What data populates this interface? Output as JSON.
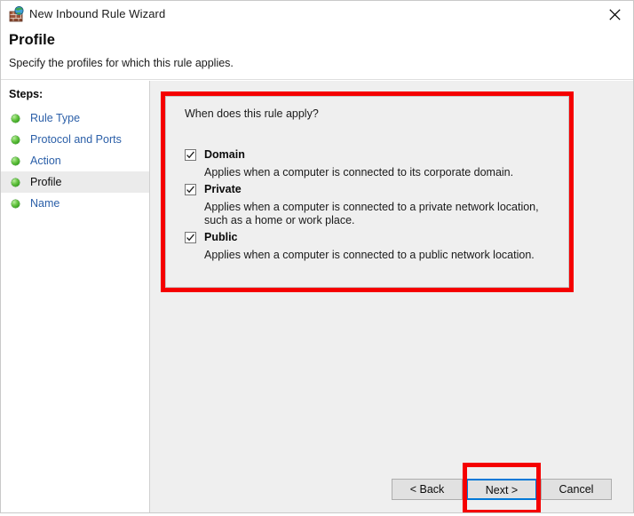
{
  "window": {
    "title": "New Inbound Rule Wizard",
    "icon": "firewall-globe-icon",
    "close_icon": "close-icon"
  },
  "header": {
    "title": "Profile",
    "subtitle": "Specify the profiles for which this rule applies."
  },
  "sidebar": {
    "label": "Steps:",
    "items": [
      {
        "label": "Rule Type",
        "current": false
      },
      {
        "label": "Protocol and Ports",
        "current": false
      },
      {
        "label": "Action",
        "current": false
      },
      {
        "label": "Profile",
        "current": true
      },
      {
        "label": "Name",
        "current": false
      }
    ]
  },
  "main": {
    "question": "When does this rule apply?",
    "profiles": [
      {
        "name": "Domain",
        "checked": true,
        "description": "Applies when a computer is connected to its corporate domain."
      },
      {
        "name": "Private",
        "checked": true,
        "description": "Applies when a computer is connected to a private network location, such as a home or work place."
      },
      {
        "name": "Public",
        "checked": true,
        "description": "Applies when a computer is connected to a public network location."
      }
    ]
  },
  "buttons": {
    "back": "< Back",
    "next": "Next >",
    "cancel": "Cancel"
  },
  "annotations": {
    "color": "#f50000",
    "targets": [
      "rule-profile-panel",
      "next-button"
    ]
  },
  "colors": {
    "link": "#2b5fa8",
    "focus_border": "#0078d7",
    "content_background": "#efefef",
    "annotation": "#f50000"
  }
}
